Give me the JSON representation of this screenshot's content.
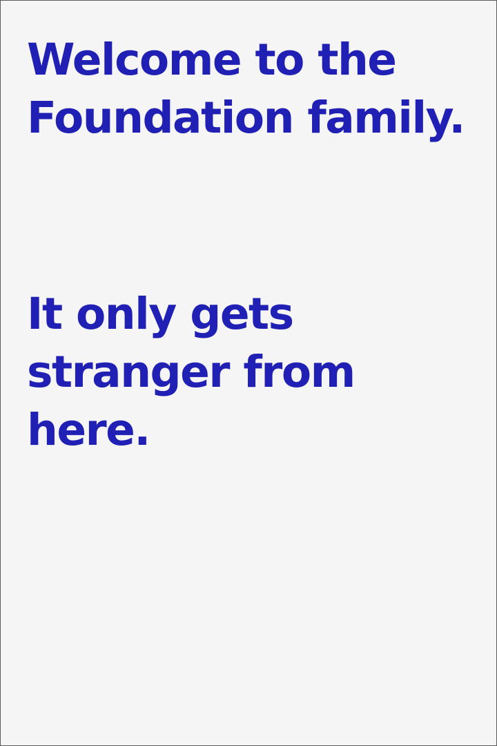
{
  "message": {
    "greeting": "Welcome to the\nFoundation family.",
    "tagline": "It only gets\nstranger from\nhere."
  },
  "colors": {
    "text": "#2020b4",
    "background": "#f5f5f5",
    "border": "#5a5a5a"
  }
}
